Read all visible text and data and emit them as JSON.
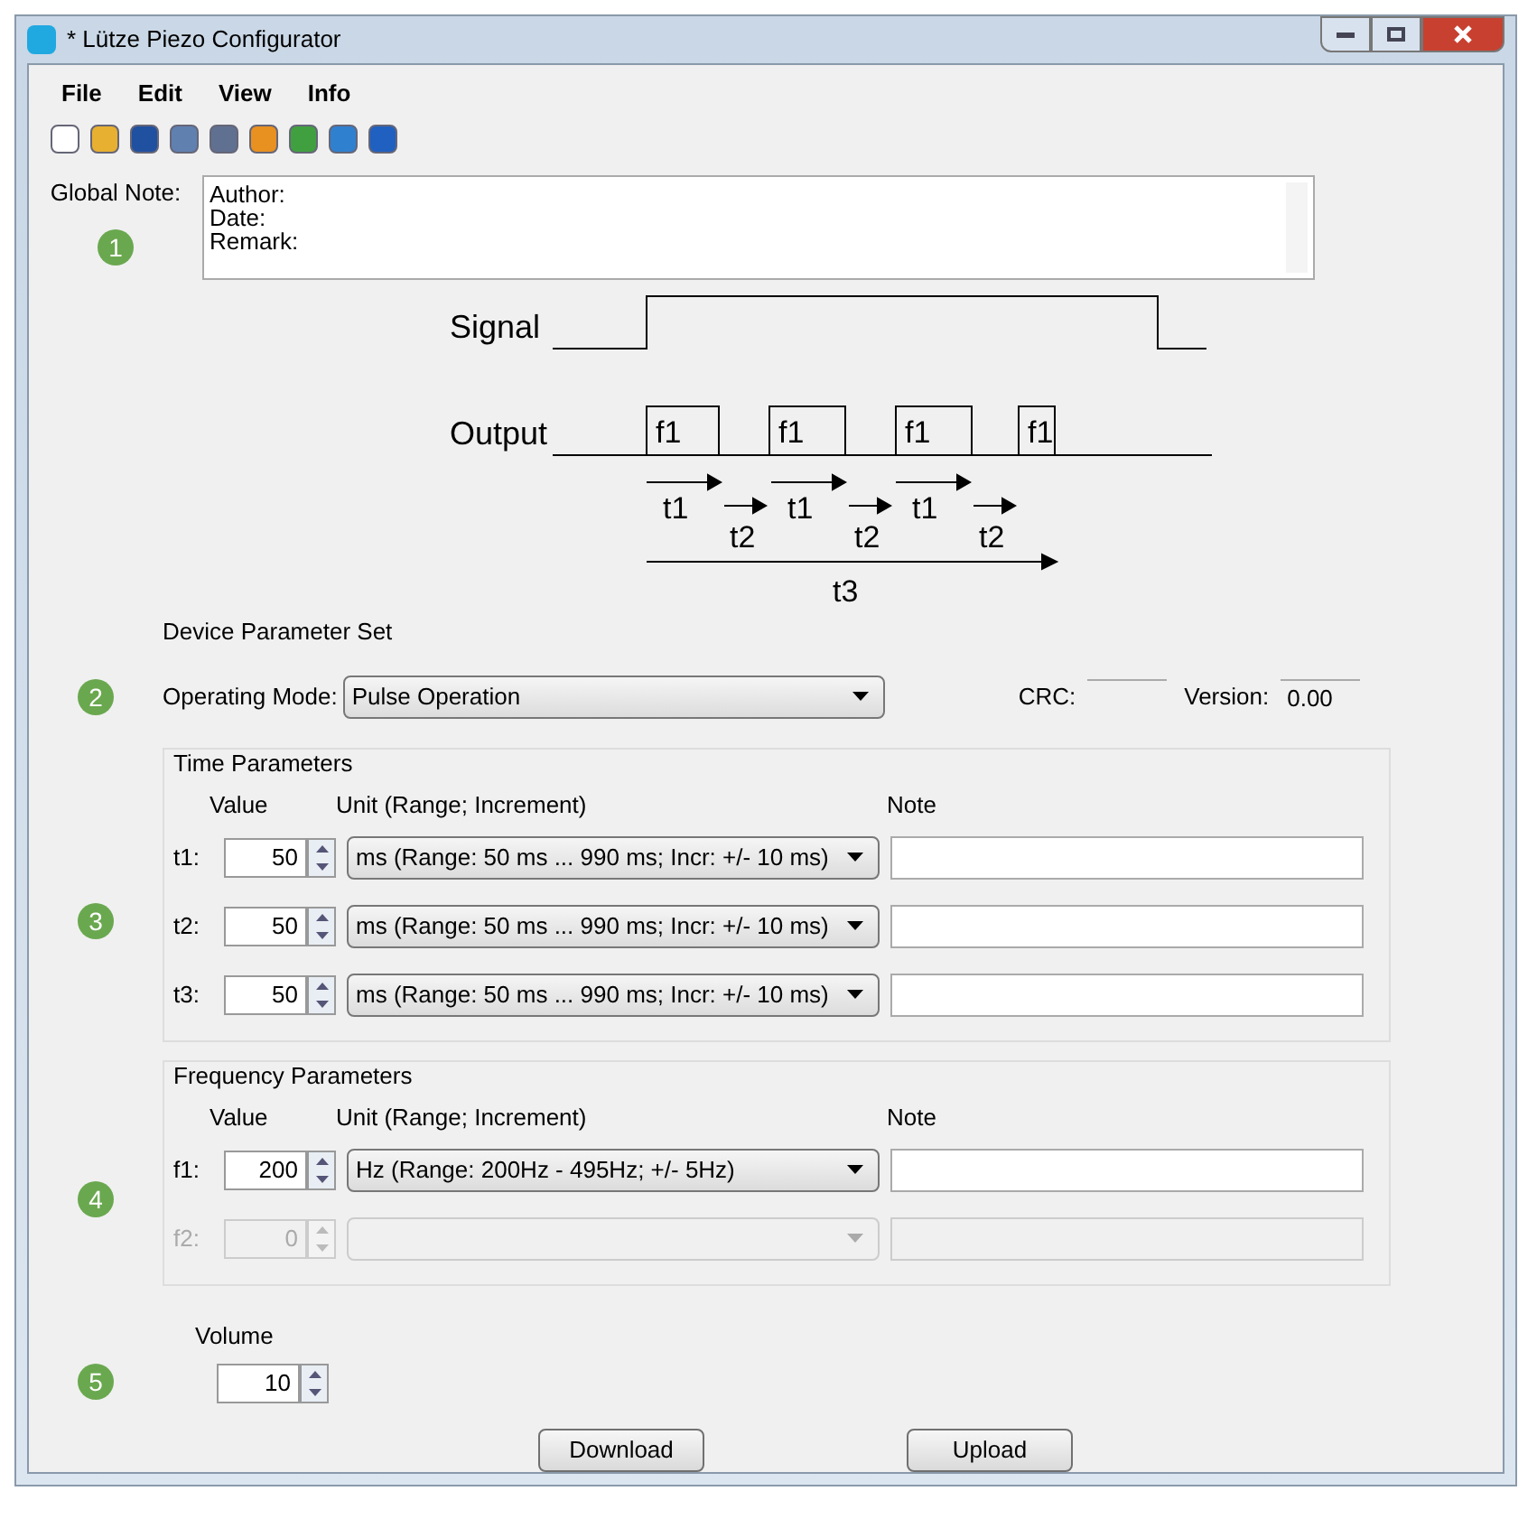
{
  "window": {
    "title": "* Lütze Piezo Configurator"
  },
  "menu": [
    "File",
    "Edit",
    "View",
    "Info"
  ],
  "global_note": {
    "label": "Global Note:",
    "lines": [
      "Author:",
      "Date:",
      "Remark:"
    ],
    "badge": "1"
  },
  "diagram": {
    "signal_label": "Signal",
    "output_label": "Output",
    "pulses": [
      "f1",
      "f1",
      "f1",
      "f1"
    ],
    "t1_labels": [
      "t1",
      "t1",
      "t1"
    ],
    "t2_labels": [
      "t2",
      "t2",
      "t2"
    ],
    "t3_label": "t3"
  },
  "device": {
    "title": "Device Parameter Set",
    "badge": "2",
    "mode_label": "Operating Mode:",
    "mode_value": "Pulse Operation",
    "crc_label": "CRC:",
    "version_label": "Version:",
    "version_value": "0.00"
  },
  "time_group": {
    "title": "Time Parameters",
    "badge": "3",
    "value_header": "Value",
    "unit_header": "Unit (Range; Increment)",
    "note_header": "Note",
    "rows": [
      {
        "label": "t1:",
        "value": "50",
        "unit": "ms (Range: 50 ms ... 990 ms; Incr: +/- 10 ms)",
        "disabled": false
      },
      {
        "label": "t2:",
        "value": "50",
        "unit": "ms (Range: 50 ms ... 990 ms; Incr: +/- 10 ms)",
        "disabled": false
      },
      {
        "label": "t3:",
        "value": "50",
        "unit": "ms (Range: 50 ms ... 990 ms; Incr: +/- 10 ms)",
        "disabled": false
      }
    ]
  },
  "frequency_group": {
    "title": "Frequency Parameters",
    "badge": "4",
    "value_header": "Value",
    "unit_header": "Unit (Range; Increment)",
    "note_header": "Note",
    "rows": [
      {
        "label": "f1:",
        "value": "200",
        "unit": "Hz (Range: 200Hz - 495Hz; +/- 5Hz)",
        "disabled": false
      },
      {
        "label": "f2:",
        "value": "0",
        "disabled": true
      }
    ]
  },
  "volume": {
    "label": "Volume",
    "value": "10",
    "badge": "5"
  },
  "buttons": [
    "Download",
    "Upload"
  ]
}
